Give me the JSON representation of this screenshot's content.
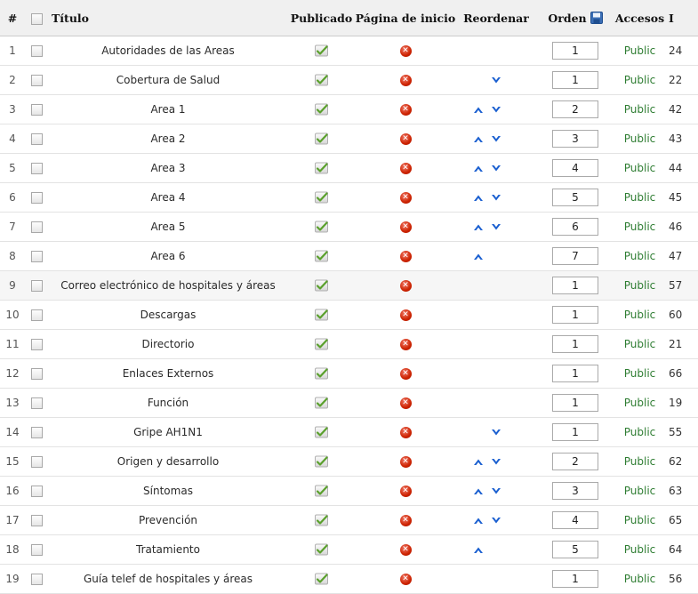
{
  "header": {
    "num": "#",
    "title": "Título",
    "published": "Publicado",
    "homepage": "Página de inicio",
    "reorder": "Reordenar",
    "order": "Orden",
    "access": "Accesos",
    "id": "I"
  },
  "colors": {
    "access_green": "#2e7d32",
    "unpublished_red": "#cc2200",
    "arrow_blue": "#1a5fd0",
    "check_green": "#5aa02c"
  },
  "rows": [
    {
      "num": "1",
      "title": "Autoridades de las Areas",
      "order": "1",
      "access": "Public",
      "id": "24",
      "up": false,
      "down": false
    },
    {
      "num": "2",
      "title": "Cobertura de Salud",
      "order": "1",
      "access": "Public",
      "id": "22",
      "up": false,
      "down": true
    },
    {
      "num": "3",
      "title": "Area 1",
      "order": "2",
      "access": "Public",
      "id": "42",
      "up": true,
      "down": true
    },
    {
      "num": "4",
      "title": "Area 2",
      "order": "3",
      "access": "Public",
      "id": "43",
      "up": true,
      "down": true
    },
    {
      "num": "5",
      "title": "Area 3",
      "order": "4",
      "access": "Public",
      "id": "44",
      "up": true,
      "down": true
    },
    {
      "num": "6",
      "title": "Area 4",
      "order": "5",
      "access": "Public",
      "id": "45",
      "up": true,
      "down": true
    },
    {
      "num": "7",
      "title": "Area 5",
      "order": "6",
      "access": "Public",
      "id": "46",
      "up": true,
      "down": true
    },
    {
      "num": "8",
      "title": "Area 6",
      "order": "7",
      "access": "Public",
      "id": "47",
      "up": true,
      "down": false
    },
    {
      "num": "9",
      "title": "Correo electrónico de hospitales y áreas",
      "order": "1",
      "access": "Public",
      "id": "57",
      "up": false,
      "down": false
    },
    {
      "num": "10",
      "title": "Descargas",
      "order": "1",
      "access": "Public",
      "id": "60",
      "up": false,
      "down": false
    },
    {
      "num": "11",
      "title": "Directorio",
      "order": "1",
      "access": "Public",
      "id": "21",
      "up": false,
      "down": false
    },
    {
      "num": "12",
      "title": "Enlaces Externos",
      "order": "1",
      "access": "Public",
      "id": "66",
      "up": false,
      "down": false
    },
    {
      "num": "13",
      "title": "Función",
      "order": "1",
      "access": "Public",
      "id": "19",
      "up": false,
      "down": false
    },
    {
      "num": "14",
      "title": "Gripe AH1N1",
      "order": "1",
      "access": "Public",
      "id": "55",
      "up": false,
      "down": true
    },
    {
      "num": "15",
      "title": "Origen y desarrollo",
      "order": "2",
      "access": "Public",
      "id": "62",
      "up": true,
      "down": true
    },
    {
      "num": "16",
      "title": "Síntomas",
      "order": "3",
      "access": "Public",
      "id": "63",
      "up": true,
      "down": true
    },
    {
      "num": "17",
      "title": "Prevención",
      "order": "4",
      "access": "Public",
      "id": "65",
      "up": true,
      "down": true
    },
    {
      "num": "18",
      "title": "Tratamiento",
      "order": "5",
      "access": "Public",
      "id": "64",
      "up": true,
      "down": false
    },
    {
      "num": "19",
      "title": "Guía telef de hospitales y áreas",
      "order": "1",
      "access": "Public",
      "id": "56",
      "up": false,
      "down": false
    }
  ]
}
